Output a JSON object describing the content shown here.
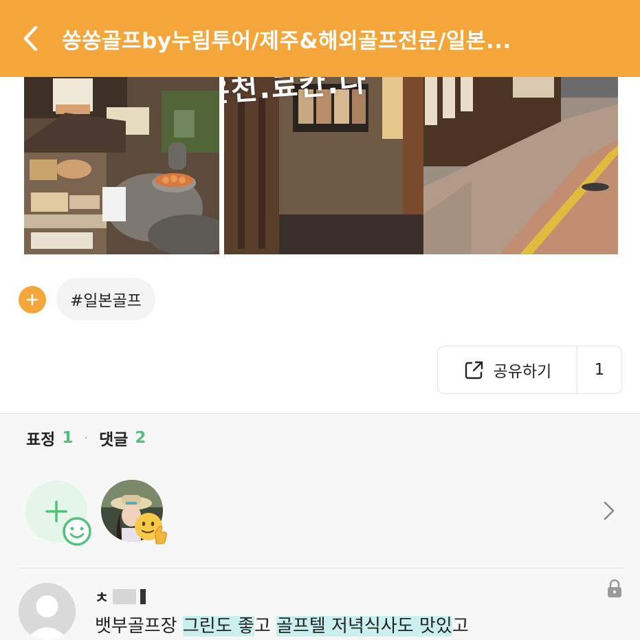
{
  "header": {
    "title": "쏭쏭골프by누림투어/제주&해외골프전문/일본...",
    "background_color": "#f4a63b",
    "back_icon": "chevron-left-icon"
  },
  "photos": {
    "overlay_text": "골프.온천.료칸.나"
  },
  "tags": {
    "add_icon": "plus-icon",
    "items": [
      "#일본골프"
    ]
  },
  "share": {
    "label": "공유하기",
    "icon": "share-icon",
    "count": "1"
  },
  "stats": {
    "reactions_label": "표정",
    "reactions_count": "1",
    "comments_label": "댓글",
    "comments_count": "2",
    "accent_color": "#4fc27a"
  },
  "reactions": {
    "add_icon": "add-emoji-icon",
    "emoji_icon": "thumbs-up-emoji-icon",
    "more_icon": "chevron-right-icon"
  },
  "comment": {
    "author_initial": "ㅊ",
    "text_segments": [
      {
        "text": "뱃부골프장 ",
        "highlight": false
      },
      {
        "text": "그린도 좋",
        "highlight": true
      },
      {
        "text": "고 ",
        "highlight": false
      },
      {
        "text": "골프텔 저녁",
        "highlight": true
      },
      {
        "text": "식사도 맛있",
        "highlight": true
      },
      {
        "text": "고",
        "highlight": false
      }
    ],
    "lock_icon": "lock-icon"
  }
}
